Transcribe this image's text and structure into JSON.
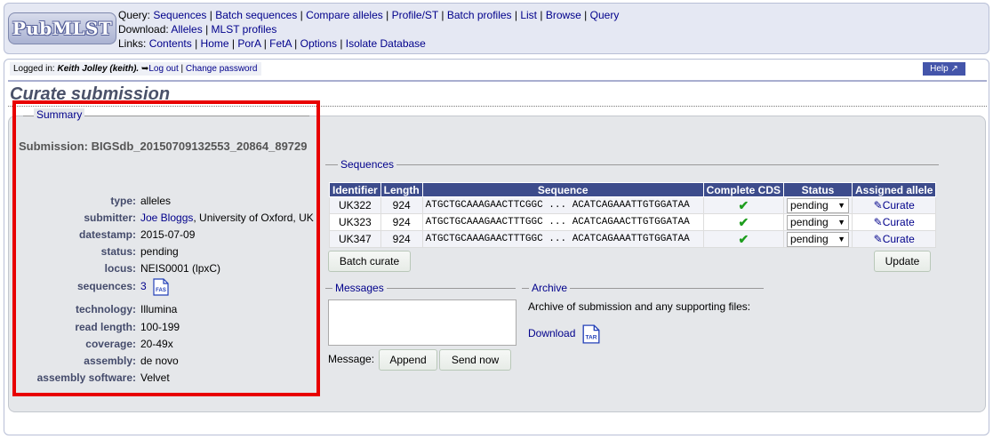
{
  "header": {
    "logo": "PubMLST",
    "query_label": "Query:",
    "query_links": [
      "Sequences",
      "Batch sequences",
      "Compare alleles",
      "Profile/ST",
      "Batch profiles",
      "List",
      "Browse",
      "Query"
    ],
    "download_label": "Download:",
    "download_links": [
      "Alleles",
      "MLST profiles"
    ],
    "links_label": "Links:",
    "links_links": [
      "Contents",
      "Home",
      "PorA",
      "FetA",
      "Options",
      "Isolate Database"
    ]
  },
  "login": {
    "prefix": "Logged in:",
    "user": "Keith Jolley (keith).",
    "logout": "Log out",
    "change_password": "Change password"
  },
  "help_label": "Help",
  "page_title": "Curate submission",
  "submission_heading": "Submission: BIGSdb_20150709132553_20864_89729",
  "summary": {
    "legend": "Summary",
    "rows": [
      {
        "key": "type:",
        "value": "alleles"
      },
      {
        "key": "submitter:",
        "link": "Joe Bloggs",
        "value": ", University of Oxford, UK"
      },
      {
        "key": "datestamp:",
        "value": "2015-07-09"
      },
      {
        "key": "status:",
        "value": "pending"
      },
      {
        "key": "locus:",
        "value": "NEIS0001 (lpxC)"
      },
      {
        "key": "sequences:",
        "link": "3",
        "icon": "fas-file-icon"
      },
      {
        "key": "technology:",
        "value": "Illumina"
      },
      {
        "key": "read length:",
        "value": "100-199"
      },
      {
        "key": "coverage:",
        "value": "20-49x"
      },
      {
        "key": "assembly:",
        "value": "de novo"
      },
      {
        "key": "assembly software:",
        "value": "Velvet"
      }
    ],
    "fas_icon_text": "FAS"
  },
  "sequences": {
    "legend": "Sequences",
    "columns": [
      "Identifier",
      "Length",
      "Sequence",
      "Complete CDS",
      "Status",
      "Assigned allele"
    ],
    "rows": [
      {
        "id": "UK322",
        "length": "924",
        "seq": "ATGCTGCAAAGAACTTCGGC ... ACATCAGAAATTGTGGATAA",
        "status": "pending",
        "action": "Curate"
      },
      {
        "id": "UK323",
        "length": "924",
        "seq": "ATGCTGCAAAGAACTTTGGC ... ACATCAGAACTTGTGGATAA",
        "status": "pending",
        "action": "Curate"
      },
      {
        "id": "UK347",
        "length": "924",
        "seq": "ATGCTGCAAAGAACTTTGGC ... ACATCAGAAATTGTGGATAA",
        "status": "pending",
        "action": "Curate"
      }
    ],
    "batch_curate": "Batch curate",
    "update": "Update"
  },
  "messages": {
    "legend": "Messages",
    "message_label": "Message:",
    "append": "Append",
    "send_now": "Send now"
  },
  "archive": {
    "legend": "Archive",
    "description": "Archive of submission and any supporting files:",
    "download": "Download",
    "tar_icon_text": "TAR"
  }
}
